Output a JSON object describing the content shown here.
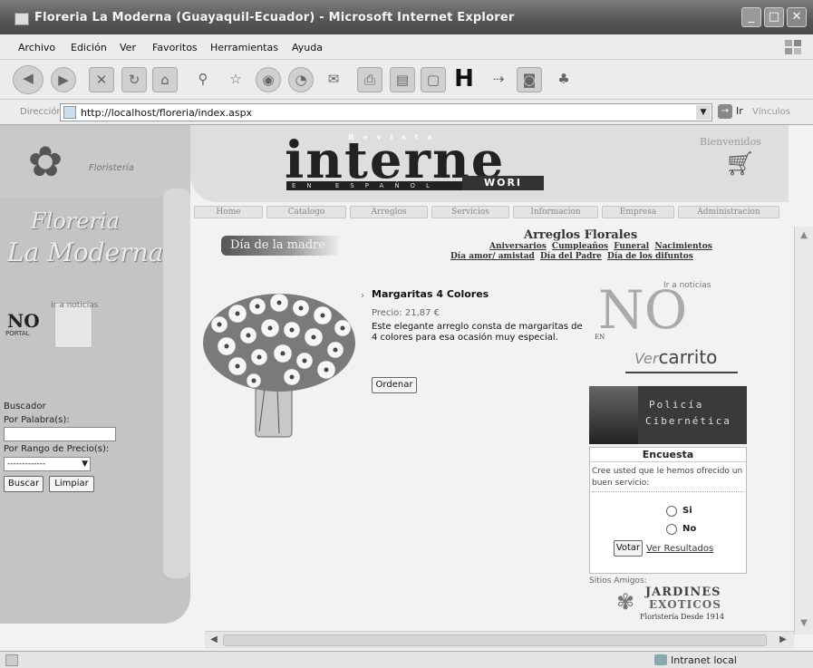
{
  "window": {
    "title": "Floreria La Moderna (Guayaquil-Ecuador) - Microsoft Internet Explorer",
    "buttons": [
      "_",
      "□",
      "✕"
    ]
  },
  "menu": [
    "Archivo",
    "Edición",
    "Ver",
    "Favoritos",
    "Herramientas",
    "Ayuda"
  ],
  "address": {
    "label": "Dirección",
    "url": "http://localhost/floreria/index.aspx",
    "go_label": "Ir",
    "links_label": "Vínculos"
  },
  "banner": {
    "revista": "Revista",
    "title": "interne",
    "sub": "EN ESPAÑOL",
    "sub2": "WORI",
    "welcome": "Bienvenidos"
  },
  "sidebar": {
    "tag": "Floristería",
    "logo_line1": "Floreria",
    "logo_line2": "La Moderna",
    "news_link": "Ir a noticias",
    "no_logo": "NO",
    "portal": "PORTAL",
    "search_title": "Buscador",
    "search_word_label": "Por Palabra(s):",
    "search_word_value": "",
    "search_price_label": "Por Rango de Precio(s):",
    "search_price_value": "-------------",
    "search_button": "Buscar",
    "clear_button": "Limpiar"
  },
  "nav": [
    "Home",
    "Catalogo",
    "Arreglos",
    "Servicios",
    "Informacion",
    "Empresa",
    "Administracion"
  ],
  "main": {
    "section_title": "Día de la madre",
    "category_title": "Arreglos Florales",
    "category_links_row1": [
      "Aniversarios",
      "Cumpleaños",
      "Funeral",
      "Nacimientos"
    ],
    "category_links_row2": [
      "Día amor/ amistad",
      "Día del Padre",
      "Día de los difuntos"
    ],
    "product": {
      "name": "Margaritas 4 Colores",
      "price": "Precio: 21,87 €",
      "description": "Este elegante arreglo consta de margaritas de 4 colores para esa ocasión muy especial.",
      "order_button": "Ordenar"
    }
  },
  "right": {
    "news_link": "Ir a noticias",
    "news_logo": "NO",
    "news_en": "EN",
    "cart_ver": "Ver",
    "cart_label": "carrito",
    "cyber_line1": "Policía",
    "cyber_line2": "Cibernética",
    "poll": {
      "title": "Encuesta",
      "question": "Cree usted que le hemos ofrecido un buen servicio:",
      "options": [
        "Si",
        "No"
      ],
      "vote_button": "Votar",
      "results_link": "Ver Resultados"
    },
    "friends_label": "Sitios Amigos:",
    "jardines_line1": "JARDINES",
    "jardines_line2": "EXOTICOS",
    "jardines_line3": "Floristería Desde 1914"
  },
  "status": {
    "zone": "Intranet local"
  }
}
